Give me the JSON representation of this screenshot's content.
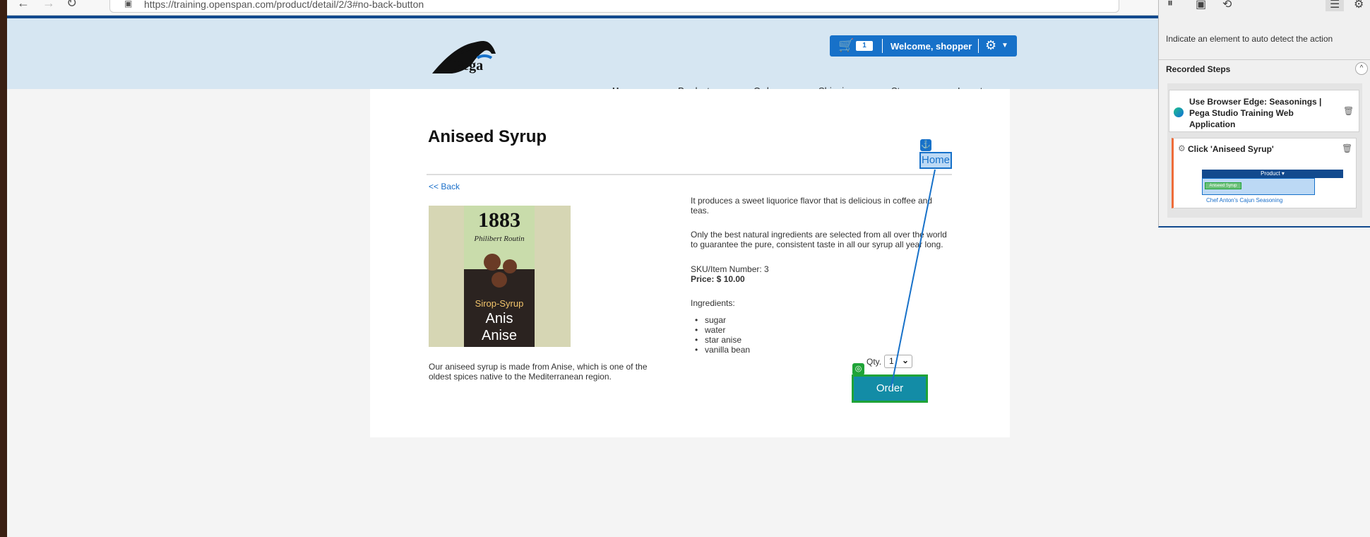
{
  "browser": {
    "url": "https://training.openspan.com/product/detail/2/3#no-back-button",
    "back_icon": "←",
    "forward_icon": "→",
    "refresh_icon": "↻",
    "lock_icon": "🔒",
    "read_aloud_icon": "A",
    "favorites_icon": "☆",
    "collections_icon": "▢"
  },
  "site": {
    "logo_text": "Pega",
    "cart_count": "1",
    "welcome_text": "Welcome, shopper",
    "nav": [
      {
        "label": "Home",
        "active": true
      },
      {
        "label": "Products"
      },
      {
        "label": "Order"
      },
      {
        "label": "Shipping"
      },
      {
        "label": "Stores"
      },
      {
        "label": "Inventory"
      }
    ]
  },
  "product": {
    "title": "Aniseed Syrup",
    "back_link": "<< Back",
    "image_alt": "1883 Philibert Routin Sirop-Syrup Anis Anise",
    "image_text": {
      "year": "1883",
      "brand": "Philibert Routin",
      "line1": "Sirop-Syrup",
      "line2": "Anis",
      "line3": "Anise"
    },
    "description_left": "Our aniseed syrup is made from Anise, which is one of the oldest spices native to the Mediterranean region.",
    "description_para1": "It produces a sweet liquorice flavor that is delicious in coffee and teas.",
    "description_para2": "Only the best natural ingredients are selected from all over the world to guarantee the pure, consistent taste in all our syrup all year long.",
    "sku": "SKU/Item Number: 3",
    "price": "Price: $ 10.00",
    "ingredients_label": "Ingredients:",
    "ingredients": [
      "sugar",
      "water",
      "star anise",
      "vanilla bean"
    ],
    "qty_label": "Qty.",
    "qty_value": "1",
    "order_button": "Order"
  },
  "overlay": {
    "home_highlight_label": "Home",
    "anchor_icon": "⚓",
    "target_icon": "◎",
    "connector_color": "#1771c9",
    "highlight_green": "#1fa337"
  },
  "recorder": {
    "hint": "Indicate an element to auto detect the action",
    "steps_header": "Recorded Steps",
    "step1_text": "Use Browser Edge: Seasonings | Pega Studio Training Web Application",
    "step2_text": "Click 'Aniseed Syrup'",
    "thumb_header": "Product ▾",
    "thumb_selected": "Aniseed Syrup",
    "thumb_link": "Chef Anton's Cajun Seasoning",
    "collapse_icon": "^",
    "trash_icon": "🗑"
  }
}
